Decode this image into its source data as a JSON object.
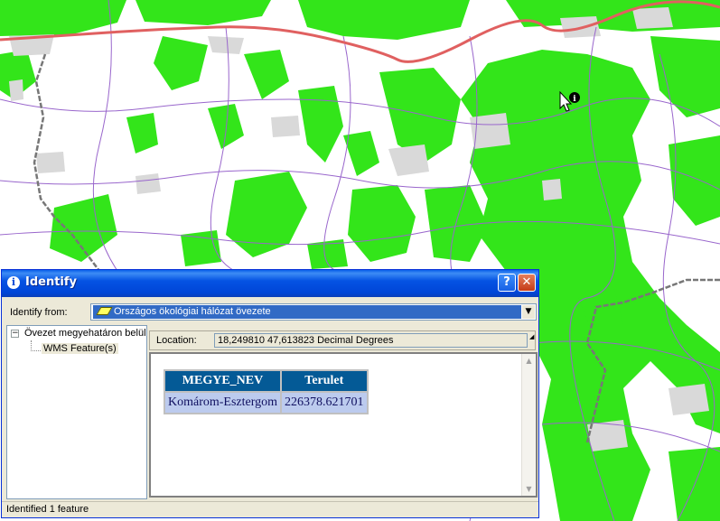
{
  "dialog": {
    "title": "Identify",
    "help_button": "?",
    "close_button": "✕",
    "identify_from_label": "Identify from:",
    "identify_from_value": "Országos ökológiai hálózat övezete",
    "tree": {
      "root": "Övezet megyehatáron belül",
      "child": "WMS Feature(s)"
    },
    "location_label": "Location:",
    "location_value": "18,249810  47,613823 Decimal Degrees",
    "table": {
      "headers": [
        "MEGYE_NEV",
        "Terulet"
      ],
      "rows": [
        [
          "Komárom-Esztergom",
          "226378.621701"
        ]
      ]
    },
    "status": "Identified 1 feature"
  },
  "map": {
    "cursor_icon": "identify-cursor-icon",
    "colors": {
      "vegetation": "#33e51a",
      "urban": "#d9d9d9",
      "border": "#e06060",
      "roads": "#9966cc"
    }
  }
}
